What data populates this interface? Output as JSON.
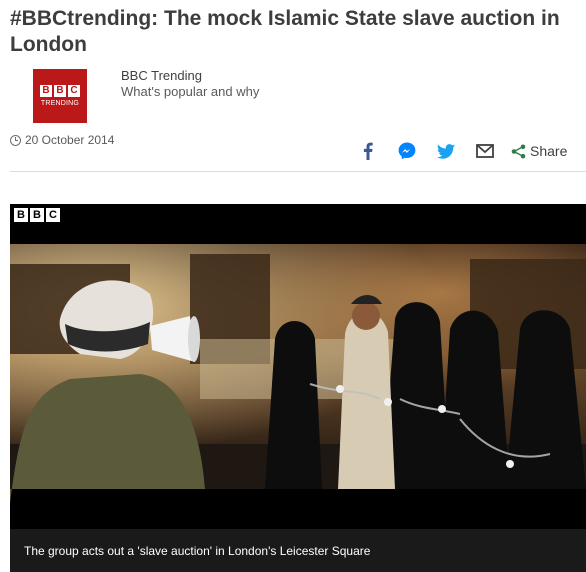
{
  "article": {
    "headline": "#BBCtrending: The mock Islamic State slave auction in London",
    "date": "20 October 2014"
  },
  "byline": {
    "logo_letters": [
      "B",
      "B",
      "C"
    ],
    "logo_sub": "TRENDING",
    "author": "BBC Trending",
    "role": "What's popular and why"
  },
  "share": {
    "icons": [
      "facebook-icon",
      "messenger-icon",
      "twitter-icon",
      "email-icon",
      "share-icon"
    ],
    "label": "Share",
    "accent": "#2f7d4a"
  },
  "media": {
    "badge_letters": [
      "B",
      "B",
      "C"
    ],
    "caption": "The group acts out a 'slave auction' in London's Leicester Square"
  },
  "colors": {
    "brand_red": "#bb1919",
    "facebook": "#3b5998",
    "messenger": "#0084ff",
    "twitter": "#1da1f2"
  }
}
